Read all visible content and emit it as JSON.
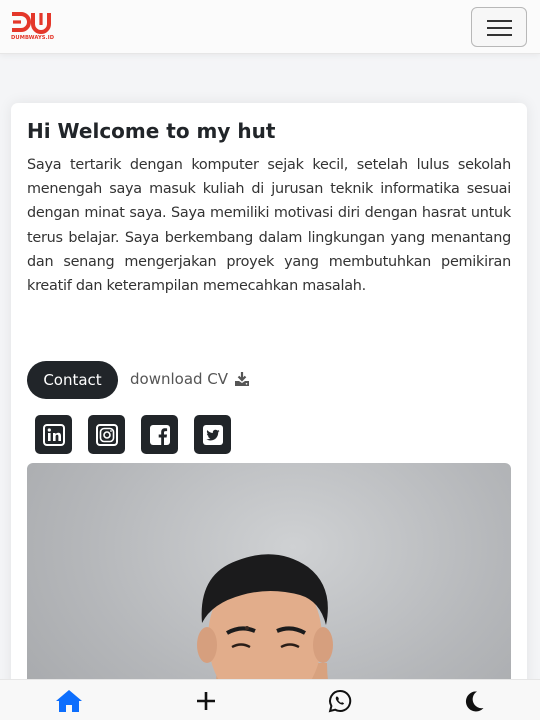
{
  "navbar": {
    "logo_text": "DUMBWAYS.ID",
    "brand_color": "#e4372a",
    "menu_icon": "hamburger-icon"
  },
  "intro": {
    "title": "Hi Welcome to my hut",
    "description": "Saya tertarik dengan komputer sejak kecil, setelah lulus sekolah menengah saya masuk kuliah di jurusan teknik informatika sesuai dengan minat saya. Saya memiliki motivasi diri dengan hasrat untuk terus belajar. Saya berkembang dalam lingkungan yang menantang dan senang mengerjakan proyek yang membutuhkan pemikiran kreatif dan keterampilan memecahkan masalah.",
    "contact_label": "Contact",
    "cv_label": "download CV"
  },
  "social": [
    "linkedin-icon",
    "instagram-icon",
    "facebook-icon",
    "twitter-icon"
  ],
  "bottom_nav": [
    "home-icon",
    "plus-icon",
    "whatsapp-icon",
    "moon-icon"
  ],
  "colors": {
    "dark": "#212529",
    "accent_blue": "#0d6efd"
  }
}
